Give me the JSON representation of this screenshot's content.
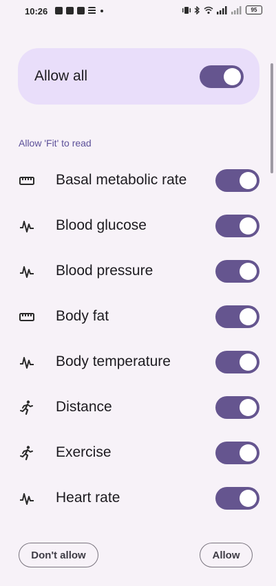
{
  "status_bar": {
    "time": "10:26",
    "battery": "95",
    "icons": [
      "notification-icon",
      "notification-icon",
      "notification-icon",
      "stack-icon",
      "dot-icon",
      "vibrate-icon",
      "bluetooth-icon",
      "wifi-icon",
      "signal-icon",
      "signal-icon",
      "battery-icon"
    ]
  },
  "allow_all": {
    "label": "Allow all",
    "enabled": true
  },
  "section_header": "Allow 'Fit' to read",
  "permissions": [
    {
      "label": "Basal metabolic rate",
      "icon": "ruler-icon",
      "enabled": true
    },
    {
      "label": "Blood glucose",
      "icon": "vitals-icon",
      "enabled": true
    },
    {
      "label": "Blood pressure",
      "icon": "vitals-icon",
      "enabled": true
    },
    {
      "label": "Body fat",
      "icon": "ruler-icon",
      "enabled": true
    },
    {
      "label": "Body temperature",
      "icon": "vitals-icon",
      "enabled": true
    },
    {
      "label": "Distance",
      "icon": "running-icon",
      "enabled": true
    },
    {
      "label": "Exercise",
      "icon": "running-icon",
      "enabled": true
    },
    {
      "label": "Heart rate",
      "icon": "vitals-icon",
      "enabled": true
    }
  ],
  "buttons": {
    "deny": "Don't allow",
    "allow": "Allow"
  },
  "colors": {
    "background": "#f7f2f8",
    "card": "#e9defa",
    "toggle_on": "#65558f",
    "accent_text": "#5c5099"
  }
}
